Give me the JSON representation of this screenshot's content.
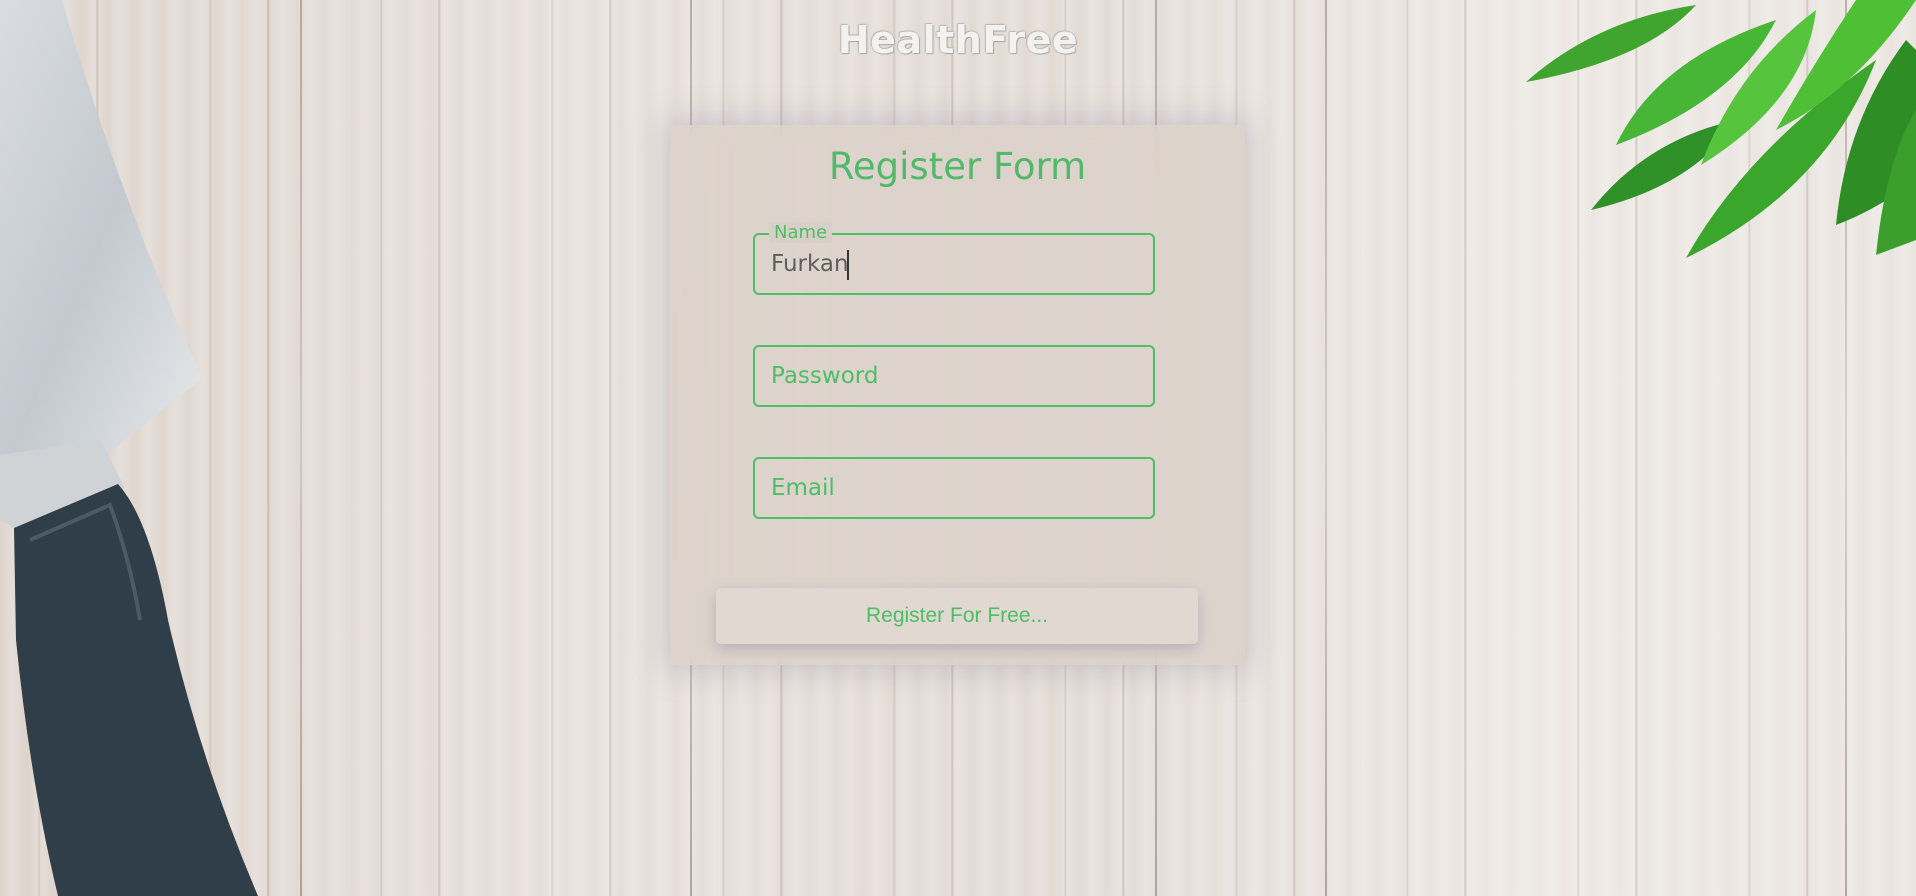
{
  "brand": {
    "logo_text": "HealthFree"
  },
  "form": {
    "title": "Register Form",
    "name_field": {
      "label": "Name",
      "value": "Furkan"
    },
    "password_field": {
      "placeholder": "Password",
      "value": ""
    },
    "email_field": {
      "placeholder": "Email",
      "value": ""
    },
    "submit_label": "Register For Free..."
  },
  "colors": {
    "accent": "#4cbf66",
    "card_background": "#d8d0c8",
    "background": "#e4ddd6"
  },
  "icons": [
    "knife-image",
    "green-leaves-image"
  ]
}
